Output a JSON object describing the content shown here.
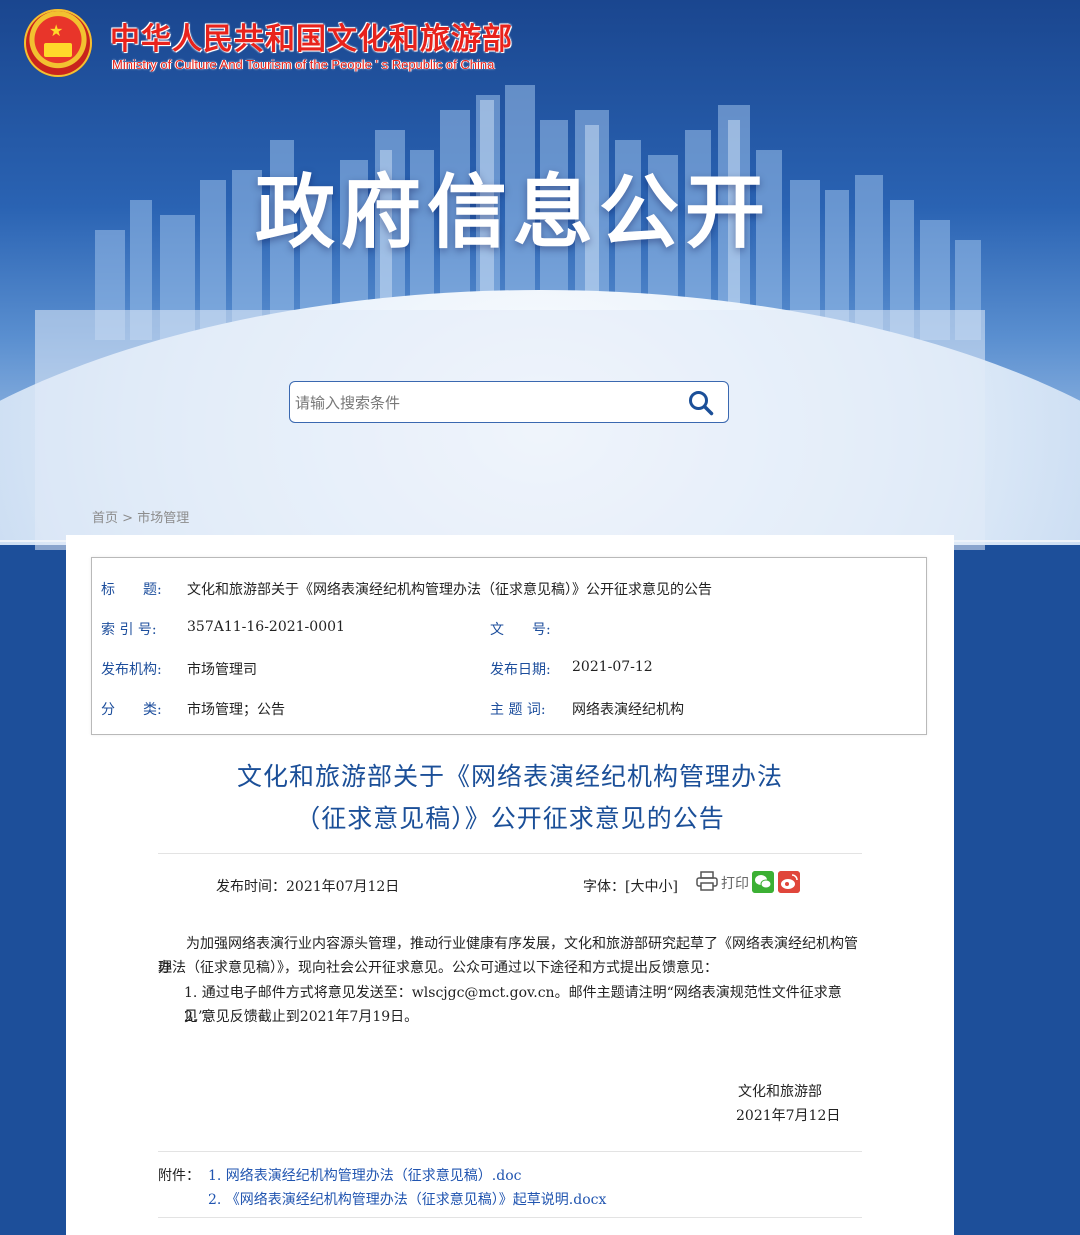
{
  "header": {
    "ministry_cn": "中华人民共和国文化和旅游部",
    "ministry_en": "Ministry of Culture And Tourism of the People ' s Republic of China",
    "banner_title": "政府信息公开"
  },
  "search": {
    "placeholder": "请输入搜索条件"
  },
  "breadcrumb": {
    "home": "首页",
    "separator": ">",
    "current": "市场管理"
  },
  "meta": {
    "title_label": "标　　题:",
    "title_value": "文化和旅游部关于《网络表演经纪机构管理办法（征求意见稿）》公开征求意见的公告",
    "index_label": "索 引 号:",
    "index_value": "357A11-16-2021-0001",
    "docno_label": "文　　号:",
    "docno_value": "",
    "publisher_label": "发布机构:",
    "publisher_value": "市场管理司",
    "date_label": "发布日期:",
    "date_value": "2021-07-12",
    "category_label": "分　　类:",
    "category_value": "市场管理；公告",
    "keywords_label": "主 题 词:",
    "keywords_value": "网络表演经纪机构"
  },
  "article": {
    "title_line1": "文化和旅游部关于《网络表演经纪机构管理办法",
    "title_line2": "（征求意见稿）》公开征求意见的公告",
    "publish_time": "发布时间：2021年07月12日",
    "font_size": "字体：[大中小]",
    "print_label": "打印",
    "para1_line1": "为加强网络表演行业内容源头管理，推动行业健康有序发展，文化和旅游部研究起草了《网络表演经纪机构管理",
    "para1_line2": "办法（征求意见稿）》，现向社会公开征求意见。公众可通过以下途径和方式提出反馈意见：",
    "item1": "1. 通过电子邮件方式将意见发送至：wlscjgc@mct.gov.cn。邮件主题请注明“网络表演规范性文件征求意见”。",
    "item2": "2. 意见反馈截止到2021年7月19日。",
    "sign_org": "文化和旅游部",
    "sign_date": "2021年7月12日",
    "attachments_label": "附件：",
    "attachments": [
      "1. 网络表演经纪机构管理办法（征求意见稿）.doc",
      "2. 《网络表演经纪机构管理办法（征求意见稿）》起草说明.docx"
    ]
  },
  "colors": {
    "brand_red": "#e8231c",
    "link_blue": "#2155b0",
    "title_blue": "#1b4f98"
  },
  "icons": [
    "national-emblem-icon",
    "search-icon",
    "print-icon",
    "wechat-icon",
    "weibo-icon"
  ]
}
